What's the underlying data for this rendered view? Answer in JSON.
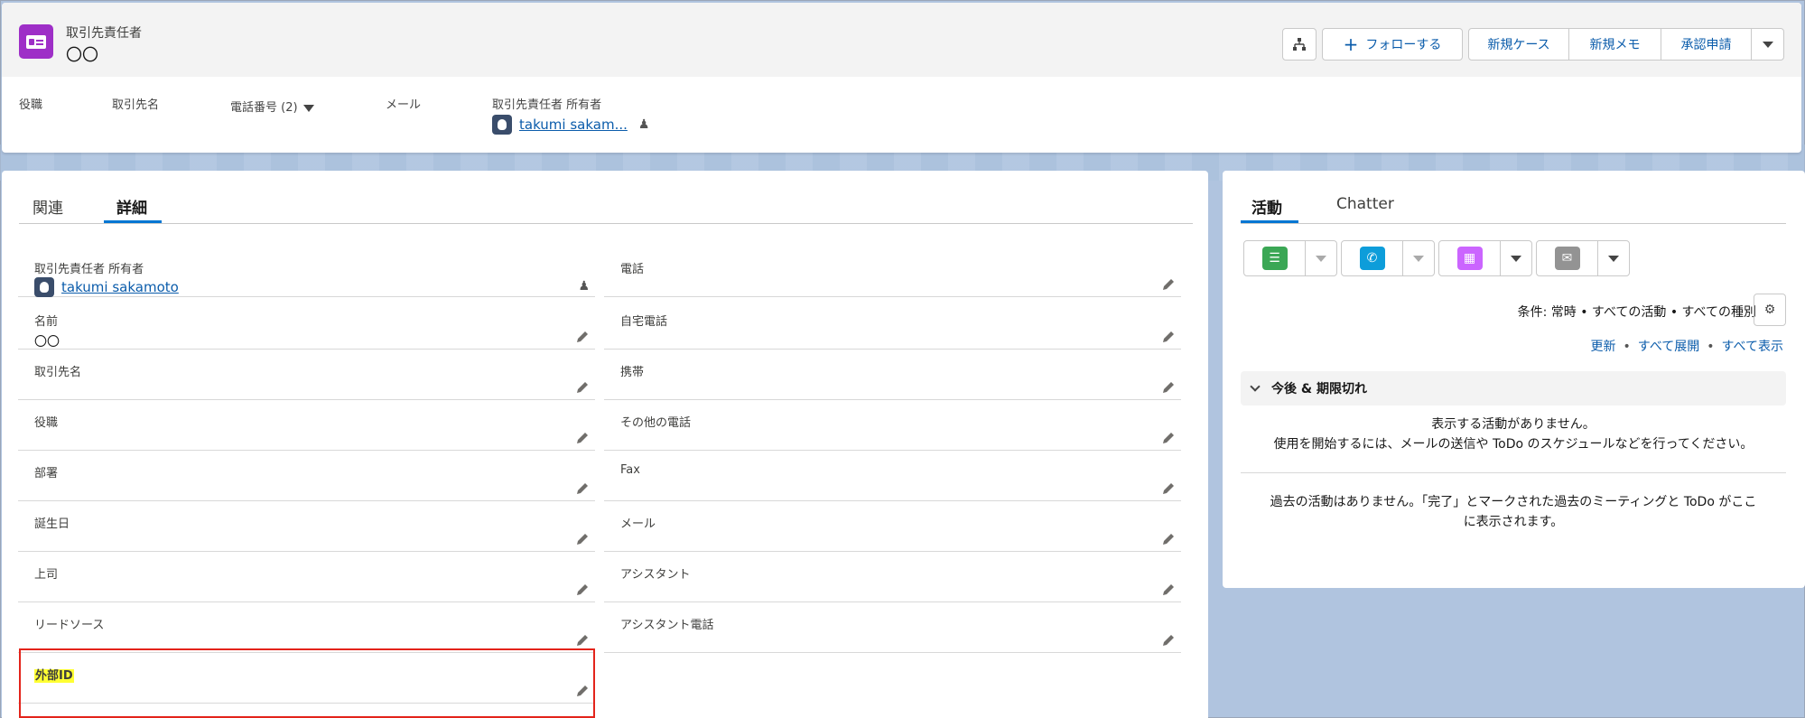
{
  "header": {
    "object_label": "取引先責任者",
    "record_name": "〇〇",
    "buttons": {
      "follow": "フォローする",
      "new_case": "新規ケース",
      "new_memo": "新規メモ",
      "approval": "承認申請"
    },
    "highlights": {
      "title_label": "役職",
      "account_label": "取引先名",
      "phone_label": "電話番号 (2)",
      "email_label": "メール",
      "owner_label": "取引先責任者 所有者",
      "owner_name": "takumi sakam..."
    }
  },
  "main": {
    "tabs": {
      "related": "関連",
      "details": "詳細"
    },
    "left_fields": [
      {
        "label": "取引先責任者 所有者",
        "value": "takumi sakamoto"
      },
      {
        "label": "名前",
        "value": "〇〇"
      },
      {
        "label": "取引先名",
        "value": ""
      },
      {
        "label": "役職",
        "value": ""
      },
      {
        "label": "部署",
        "value": ""
      },
      {
        "label": "誕生日",
        "value": ""
      },
      {
        "label": "上司",
        "value": ""
      },
      {
        "label": "リードソース",
        "value": ""
      },
      {
        "label": "外部ID",
        "value": ""
      }
    ],
    "right_fields": [
      {
        "label": "電話",
        "value": ""
      },
      {
        "label": "自宅電話",
        "value": ""
      },
      {
        "label": "携帯",
        "value": ""
      },
      {
        "label": "その他の電話",
        "value": ""
      },
      {
        "label": "Fax",
        "value": ""
      },
      {
        "label": "メール",
        "value": ""
      },
      {
        "label": "アシスタント",
        "value": ""
      },
      {
        "label": "アシスタント電話",
        "value": ""
      }
    ]
  },
  "side": {
    "tabs": {
      "activity": "活動",
      "chatter": "Chatter"
    },
    "filter": "条件: 常時 • すべての活動 • すべての種別",
    "links": {
      "refresh": "更新",
      "expand_all": "すべて展開",
      "show_all": "すべて表示"
    },
    "upcoming_label": "今後 & 期限切れ",
    "empty_line1": "表示する活動がありません。",
    "empty_line2": "使用を開始するには、メールの送信や ToDo のスケジュールなどを行ってください。",
    "past_line1": "過去の活動はありません。「完了」とマークされた過去のミーティングと ToDo がここ",
    "past_line2": "に表示されます。",
    "colors": {
      "task": "#3ba755",
      "call": "#0d9dda",
      "event": "#cb65ff",
      "email": "#939393"
    }
  },
  "colors": {
    "accent": "#0176d3",
    "record_icon": "#9e2fc7",
    "highlight_box": "#e3241b",
    "highlight_text_bg": "#ffff33"
  }
}
